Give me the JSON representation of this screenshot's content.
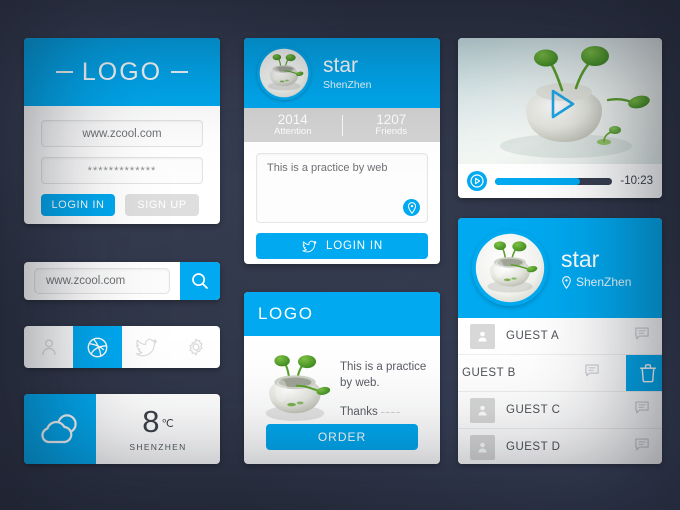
{
  "theme": {
    "accent": "#00a9f0",
    "background": "#2e3446",
    "card": "#ffffff",
    "muted": "#d4d4d4"
  },
  "login_card": {
    "logo": "LOGO",
    "username_value": "www.zcool.com",
    "password_value": "*************",
    "login_button": "LOGIN IN",
    "signup_button": "SIGN UP"
  },
  "search_widget": {
    "value": "www.zcool.com",
    "icon": "search-icon"
  },
  "icon_bar": {
    "items": [
      {
        "name": "user-icon",
        "active": false
      },
      {
        "name": "dribbble-icon",
        "active": true
      },
      {
        "name": "twitter-icon",
        "active": false
      },
      {
        "name": "gear-icon",
        "active": false
      }
    ]
  },
  "weather_widget": {
    "icon": "cloud-icon",
    "temperature": "8",
    "unit": "℃",
    "city": "SHENZHEN"
  },
  "profile_card": {
    "name": "star",
    "location": "ShenZhen",
    "stats": [
      {
        "value": "2014",
        "label": "Attention"
      },
      {
        "value": "1207",
        "label": "Friends"
      }
    ],
    "textarea_value": "This is a practice by web",
    "pin_icon": "location-pin-icon",
    "login_button": "LOGIN IN",
    "login_button_icon": "twitter-icon"
  },
  "order_card": {
    "logo": "LOGO",
    "description": "This is a practice by web.",
    "thanks": "Thanks",
    "thanks_tail": "~~~~",
    "button": "ORDER"
  },
  "video_card": {
    "play_overlay_icon": "play-triangle-icon",
    "play_button_icon": "play-icon",
    "progress_percent": 72,
    "time_remaining": "-10:23"
  },
  "contact_card": {
    "name": "star",
    "location": "ShenZhen",
    "location_icon": "location-pin-icon",
    "rows": [
      {
        "label": "GUEST A",
        "swiped": false,
        "message_icon": "message-icon"
      },
      {
        "label": "GUEST B",
        "swiped": true,
        "message_icon": "message-icon",
        "delete_icon": "trash-icon"
      },
      {
        "label": "GUEST C",
        "swiped": false,
        "message_icon": "message-icon"
      },
      {
        "label": "GUEST D",
        "swiped": false,
        "message_icon": "message-icon"
      }
    ]
  }
}
